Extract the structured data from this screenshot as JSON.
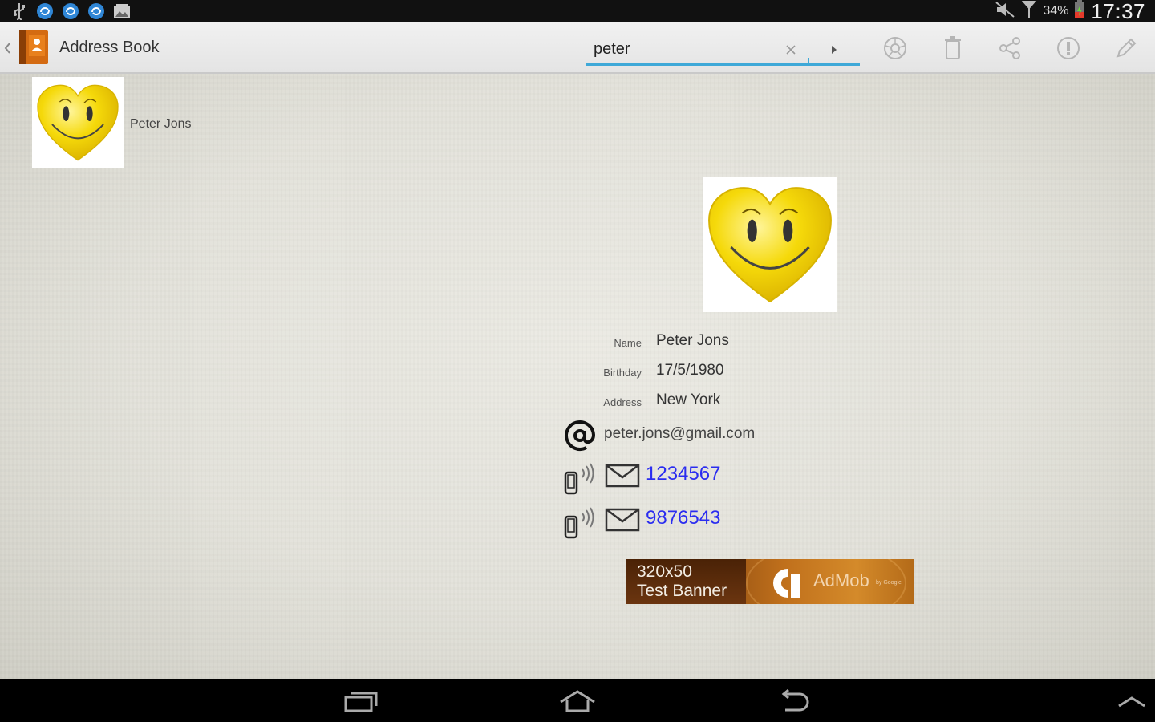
{
  "status_bar": {
    "notification_icons": [
      "usb-icon",
      "sync-icon",
      "sync-icon",
      "sync-icon",
      "gallery-icon"
    ],
    "battery_text": "34%",
    "time": "17:37"
  },
  "action_bar": {
    "title": "Address Book",
    "search": {
      "value": "peter",
      "placeholder": ""
    },
    "actions": [
      "camera-icon",
      "delete-icon",
      "share-icon",
      "info-icon",
      "edit-icon"
    ]
  },
  "contact_list": [
    {
      "name": "Peter Jons"
    }
  ],
  "contact_detail": {
    "fields": [
      {
        "label": "Name",
        "value": "Peter Jons"
      },
      {
        "label": "Birthday",
        "value": "17/5/1980"
      },
      {
        "label": "Address",
        "value": "New York"
      }
    ],
    "email": "peter.jons@gmail.com",
    "phones": [
      "1234567",
      "9876543"
    ]
  },
  "ad_banner": {
    "size_text": "320x50",
    "test_text": "Test Banner",
    "brand": "AdMob",
    "by": "by Google"
  },
  "colors": {
    "accent": "#3fa9d8",
    "phone_link": "#2a2cf0",
    "smiley_yellow": "#f5d90a"
  }
}
